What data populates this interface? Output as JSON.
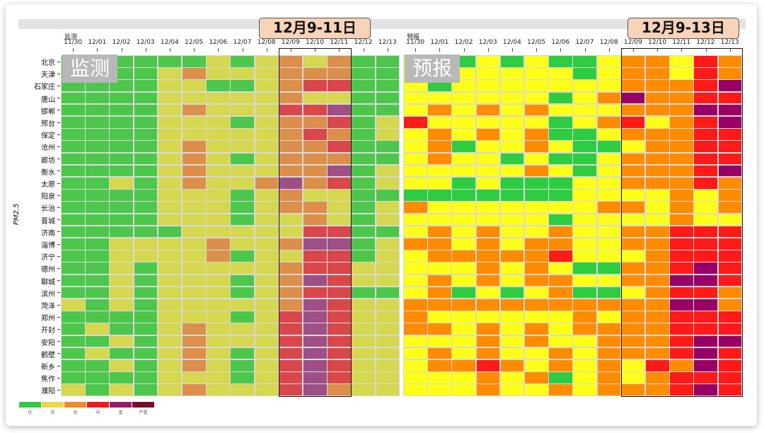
{
  "chart_data": {
    "type": "heatmap",
    "ylabel": "PM2.5",
    "color_scale": {
      "levels": [
        "优",
        "良",
        "轻",
        "中",
        "重",
        "严重"
      ],
      "colors": [
        "#2ecc40",
        "#f0d54a",
        "#f08a24",
        "#f01a1a",
        "#9b1b6b",
        "#7a0b2a"
      ]
    },
    "cities": [
      "北京",
      "天津",
      "石家庄",
      "唐山",
      "邯郸",
      "邢台",
      "保定",
      "沧州",
      "廊坊",
      "衡水",
      "太原",
      "阳泉",
      "长治",
      "晋城",
      "济南",
      "淄博",
      "济宁",
      "德州",
      "聊城",
      "滨州",
      "菏泽",
      "郑州",
      "开封",
      "安阳",
      "鹤壁",
      "新乡",
      "焦作",
      "濮阳"
    ],
    "panels": [
      {
        "name": "监测",
        "dates": [
          "11/30",
          "12/01",
          "12/02",
          "12/03",
          "12/04",
          "12/05",
          "12/06",
          "12/07",
          "12/08",
          "12/09",
          "12/10",
          "12/11",
          "12/12",
          "12/13"
        ],
        "highlight": {
          "label": "12月9-11日",
          "from": "12/09",
          "to": "12/11"
        },
        "palette": [
          "#4cc74c",
          "#d5d84e",
          "#dc8f4a",
          "#d9474c",
          "#9e4f88",
          "#7a0b2a"
        ],
        "values": [
          [
            0,
            0,
            0,
            0,
            0,
            0,
            1,
            0,
            1,
            2,
            1,
            2,
            0,
            0
          ],
          [
            0,
            0,
            0,
            0,
            1,
            2,
            1,
            1,
            1,
            2,
            2,
            2,
            0,
            0
          ],
          [
            0,
            0,
            0,
            0,
            1,
            1,
            0,
            0,
            1,
            2,
            3,
            3,
            0,
            0
          ],
          [
            0,
            0,
            0,
            0,
            1,
            1,
            1,
            1,
            1,
            2,
            1,
            1,
            0,
            0
          ],
          [
            0,
            0,
            0,
            0,
            1,
            2,
            1,
            1,
            1,
            3,
            3,
            4,
            0,
            0
          ],
          [
            0,
            0,
            0,
            0,
            1,
            1,
            1,
            0,
            1,
            2,
            2,
            3,
            0,
            1
          ],
          [
            0,
            0,
            0,
            0,
            1,
            1,
            1,
            1,
            1,
            2,
            3,
            2,
            0,
            1
          ],
          [
            0,
            0,
            0,
            0,
            1,
            2,
            1,
            1,
            1,
            2,
            2,
            3,
            0,
            0
          ],
          [
            0,
            0,
            0,
            0,
            1,
            2,
            1,
            0,
            1,
            2,
            2,
            2,
            0,
            0
          ],
          [
            0,
            0,
            0,
            0,
            1,
            2,
            1,
            1,
            1,
            2,
            2,
            4,
            0,
            1
          ],
          [
            0,
            0,
            1,
            0,
            1,
            2,
            1,
            1,
            2,
            4,
            2,
            3,
            0,
            1
          ],
          [
            0,
            0,
            0,
            0,
            1,
            1,
            1,
            0,
            1,
            2,
            1,
            1,
            0,
            0
          ],
          [
            0,
            0,
            0,
            0,
            1,
            1,
            1,
            0,
            1,
            2,
            2,
            1,
            0,
            1
          ],
          [
            0,
            0,
            0,
            0,
            1,
            1,
            1,
            0,
            1,
            1,
            2,
            1,
            0,
            1
          ],
          [
            0,
            0,
            0,
            0,
            0,
            1,
            1,
            1,
            1,
            1,
            3,
            3,
            0,
            0
          ],
          [
            0,
            0,
            1,
            1,
            1,
            1,
            2,
            1,
            1,
            2,
            4,
            4,
            0,
            1
          ],
          [
            0,
            0,
            1,
            1,
            1,
            1,
            2,
            0,
            1,
            1,
            3,
            3,
            0,
            1
          ],
          [
            0,
            0,
            1,
            0,
            1,
            1,
            1,
            1,
            1,
            2,
            3,
            3,
            1,
            1
          ],
          [
            0,
            0,
            1,
            0,
            1,
            1,
            1,
            0,
            1,
            2,
            4,
            3,
            1,
            1
          ],
          [
            0,
            0,
            1,
            0,
            1,
            1,
            1,
            0,
            1,
            2,
            3,
            3,
            0,
            0
          ],
          [
            1,
            0,
            1,
            0,
            1,
            1,
            1,
            1,
            1,
            2,
            4,
            3,
            1,
            1
          ],
          [
            0,
            0,
            0,
            0,
            1,
            1,
            1,
            0,
            1,
            3,
            4,
            3,
            1,
            1
          ],
          [
            0,
            1,
            0,
            0,
            1,
            2,
            1,
            1,
            1,
            3,
            4,
            3,
            1,
            1
          ],
          [
            0,
            0,
            1,
            0,
            1,
            2,
            1,
            1,
            1,
            3,
            4,
            3,
            1,
            1
          ],
          [
            0,
            1,
            0,
            0,
            1,
            2,
            1,
            0,
            1,
            3,
            4,
            3,
            1,
            1
          ],
          [
            0,
            0,
            1,
            0,
            1,
            2,
            1,
            0,
            1,
            3,
            4,
            3,
            1,
            1
          ],
          [
            0,
            0,
            0,
            0,
            1,
            1,
            1,
            0,
            1,
            3,
            4,
            3,
            1,
            1
          ],
          [
            1,
            0,
            1,
            0,
            1,
            2,
            1,
            1,
            1,
            3,
            4,
            2,
            1,
            1
          ]
        ]
      },
      {
        "name": "预报",
        "dates": [
          "11/30",
          "12/01",
          "12/02",
          "12/03",
          "12/04",
          "12/05",
          "12/06",
          "12/07",
          "12/08",
          "12/09",
          "12/10",
          "12/11",
          "12/12",
          "12/13"
        ],
        "highlight": {
          "label": "12月9-13日",
          "from": "12/09",
          "to": "12/13"
        },
        "palette": [
          "#2ecc40",
          "#ffff1a",
          "#ff8c00",
          "#ff1a1a",
          "#990066",
          "#7a0b2a"
        ],
        "values": [
          [
            1,
            1,
            0,
            1,
            0,
            1,
            0,
            0,
            1,
            2,
            2,
            1,
            3,
            2
          ],
          [
            1,
            1,
            1,
            1,
            1,
            1,
            1,
            0,
            1,
            2,
            2,
            1,
            3,
            2
          ],
          [
            1,
            0,
            1,
            1,
            1,
            1,
            1,
            1,
            1,
            2,
            2,
            2,
            3,
            4
          ],
          [
            1,
            1,
            1,
            1,
            1,
            1,
            0,
            1,
            2,
            4,
            2,
            2,
            3,
            3
          ],
          [
            1,
            2,
            1,
            2,
            1,
            2,
            1,
            1,
            1,
            2,
            2,
            2,
            4,
            4
          ],
          [
            3,
            1,
            1,
            1,
            1,
            1,
            0,
            1,
            2,
            3,
            1,
            2,
            3,
            4
          ],
          [
            1,
            2,
            1,
            2,
            1,
            2,
            0,
            0,
            1,
            2,
            2,
            2,
            3,
            3
          ],
          [
            1,
            2,
            0,
            1,
            1,
            2,
            1,
            0,
            0,
            1,
            2,
            2,
            3,
            3
          ],
          [
            1,
            2,
            1,
            1,
            0,
            1,
            0,
            0,
            1,
            2,
            2,
            2,
            3,
            3
          ],
          [
            1,
            1,
            1,
            1,
            1,
            2,
            1,
            0,
            1,
            2,
            2,
            2,
            3,
            4
          ],
          [
            1,
            1,
            0,
            1,
            0,
            0,
            0,
            1,
            1,
            2,
            2,
            2,
            3,
            2
          ],
          [
            0,
            0,
            0,
            0,
            0,
            0,
            0,
            1,
            1,
            1,
            1,
            2,
            1,
            2
          ],
          [
            2,
            1,
            1,
            1,
            1,
            1,
            1,
            1,
            2,
            2,
            1,
            2,
            1,
            2
          ],
          [
            1,
            1,
            1,
            1,
            1,
            1,
            0,
            1,
            1,
            1,
            1,
            2,
            1,
            1
          ],
          [
            1,
            2,
            1,
            2,
            1,
            1,
            2,
            1,
            1,
            2,
            2,
            3,
            3,
            3
          ],
          [
            2,
            2,
            1,
            2,
            1,
            2,
            2,
            1,
            1,
            2,
            2,
            3,
            3,
            3
          ],
          [
            1,
            2,
            2,
            2,
            2,
            2,
            3,
            1,
            1,
            1,
            2,
            3,
            3,
            3
          ],
          [
            1,
            1,
            1,
            2,
            1,
            2,
            1,
            0,
            0,
            2,
            2,
            3,
            4,
            3
          ],
          [
            1,
            2,
            1,
            2,
            1,
            2,
            2,
            1,
            1,
            2,
            2,
            4,
            4,
            3
          ],
          [
            1,
            2,
            0,
            1,
            0,
            1,
            2,
            0,
            0,
            1,
            2,
            3,
            3,
            2
          ],
          [
            2,
            2,
            2,
            2,
            2,
            2,
            2,
            2,
            2,
            2,
            2,
            4,
            4,
            2
          ],
          [
            2,
            1,
            1,
            1,
            1,
            1,
            1,
            2,
            1,
            2,
            2,
            3,
            3,
            3
          ],
          [
            2,
            2,
            1,
            2,
            1,
            2,
            1,
            2,
            2,
            2,
            2,
            3,
            3,
            3
          ],
          [
            1,
            1,
            1,
            2,
            1,
            2,
            1,
            1,
            2,
            2,
            2,
            3,
            4,
            4
          ],
          [
            1,
            2,
            1,
            2,
            1,
            1,
            2,
            1,
            2,
            2,
            2,
            3,
            4,
            3
          ],
          [
            1,
            2,
            2,
            3,
            2,
            1,
            2,
            1,
            2,
            1,
            3,
            2,
            4,
            3
          ],
          [
            1,
            1,
            1,
            2,
            1,
            2,
            0,
            1,
            2,
            1,
            2,
            3,
            3,
            3
          ],
          [
            1,
            1,
            1,
            2,
            1,
            1,
            2,
            1,
            2,
            2,
            2,
            3,
            4,
            3
          ]
        ]
      }
    ]
  }
}
